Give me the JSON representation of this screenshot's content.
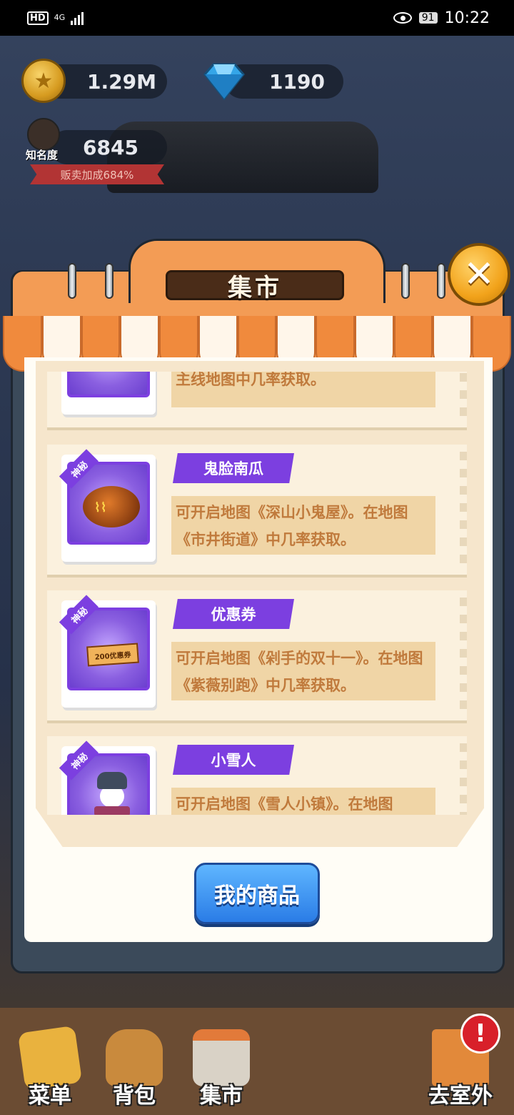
{
  "status_bar": {
    "hd": "HD",
    "network": "4G",
    "battery": "91",
    "time": "10:22"
  },
  "hud": {
    "coins": "1.29M",
    "gems": "1190",
    "fame_label": "知名度",
    "fame_value": "6845",
    "sale_bonus": "贩卖加成684%"
  },
  "shop": {
    "title": "集市",
    "close_symbol": "✕",
    "items": [
      {
        "name": "",
        "badge": "",
        "desc": "主线地图中几率获取。",
        "icon": "box-icon"
      },
      {
        "name": "鬼脸南瓜",
        "badge": "神秘",
        "desc": "可开启地图《深山小鬼屋》。在地图《市井街道》中几率获取。",
        "icon": "pumpkin-icon"
      },
      {
        "name": "优惠券",
        "badge": "神秘",
        "desc": "可开启地图《剁手的双十一》。在地图《紫薇别跑》中几率获取。",
        "icon": "coupon-icon",
        "coupon_text": "200优惠券"
      },
      {
        "name": "小雪人",
        "badge": "神秘",
        "desc": "可开启地图《雪人小镇》。在地图",
        "icon": "snowman-icon"
      }
    ],
    "my_goods_button": "我的商品"
  },
  "nav": {
    "menu": "菜单",
    "backpack": "背包",
    "market": "集市",
    "go_outside": "去室外",
    "alert": "!"
  },
  "colors": {
    "accent_purple": "#7c3fe0",
    "awning_orange": "#f08a3d",
    "button_blue": "#2a7ce6",
    "desc_text": "#c07a3c"
  }
}
